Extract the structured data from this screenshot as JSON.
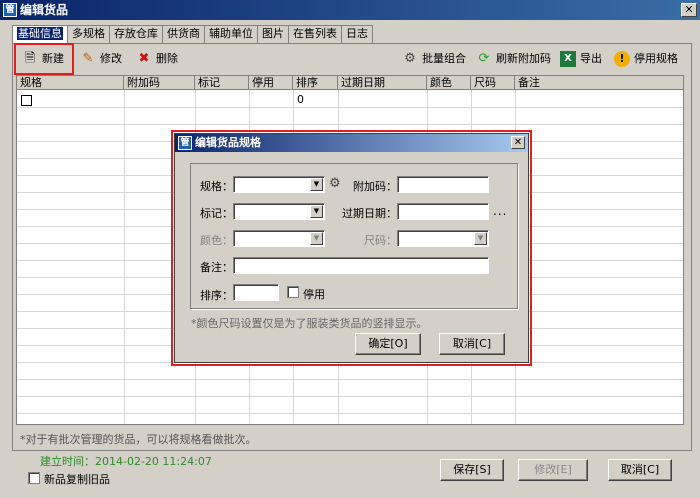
{
  "window": {
    "title": "编辑货品",
    "close_glyph": "✕",
    "icon_glyph": "管"
  },
  "tabs": [
    "基础信息",
    "多规格",
    "存放仓库",
    "供货商",
    "辅助单位",
    "图片",
    "在售列表",
    "日志"
  ],
  "toolbar": {
    "new": "新建",
    "edit": "修改",
    "delete": "删除",
    "batch_combine": "批量组合",
    "refresh_barcode": "刷新附加码",
    "export": "导出",
    "disable_spec": "停用规格"
  },
  "grid": {
    "columns": [
      "规格",
      "附加码",
      "标记",
      "停用",
      "排序",
      "过期日期",
      "颜色",
      "尺码",
      "备注"
    ],
    "rows": [
      {
        "sort": "0"
      }
    ]
  },
  "dialog": {
    "title": "编辑货品规格",
    "close_glyph": "✕",
    "labels": {
      "spec": "规格：",
      "barcode": "附加码：",
      "mark": "标记：",
      "expiry": "过期日期：",
      "color": "颜色：",
      "size": "尺码：",
      "remark": "备注：",
      "sort": "排序：",
      "disabled": "停用"
    },
    "ellipsis": "...",
    "note": "*颜色尺码设置仅是为了服装类货品的竖排显示。",
    "ok": "确定[O]",
    "cancel": "取消[C]"
  },
  "footer": {
    "hint": "*对于有批次管理的货品，可以将规格看做批次。",
    "created": "建立时间：2014-02-20 11:24:07",
    "copy_old": "新品复制旧品",
    "save": "保存[S]",
    "modify": "修改[E]",
    "cancel": "取消[C]"
  },
  "colors": {
    "title_blue": "#0a246a",
    "highlight_red": "#e02020",
    "created_green": "#2a8a2a"
  }
}
